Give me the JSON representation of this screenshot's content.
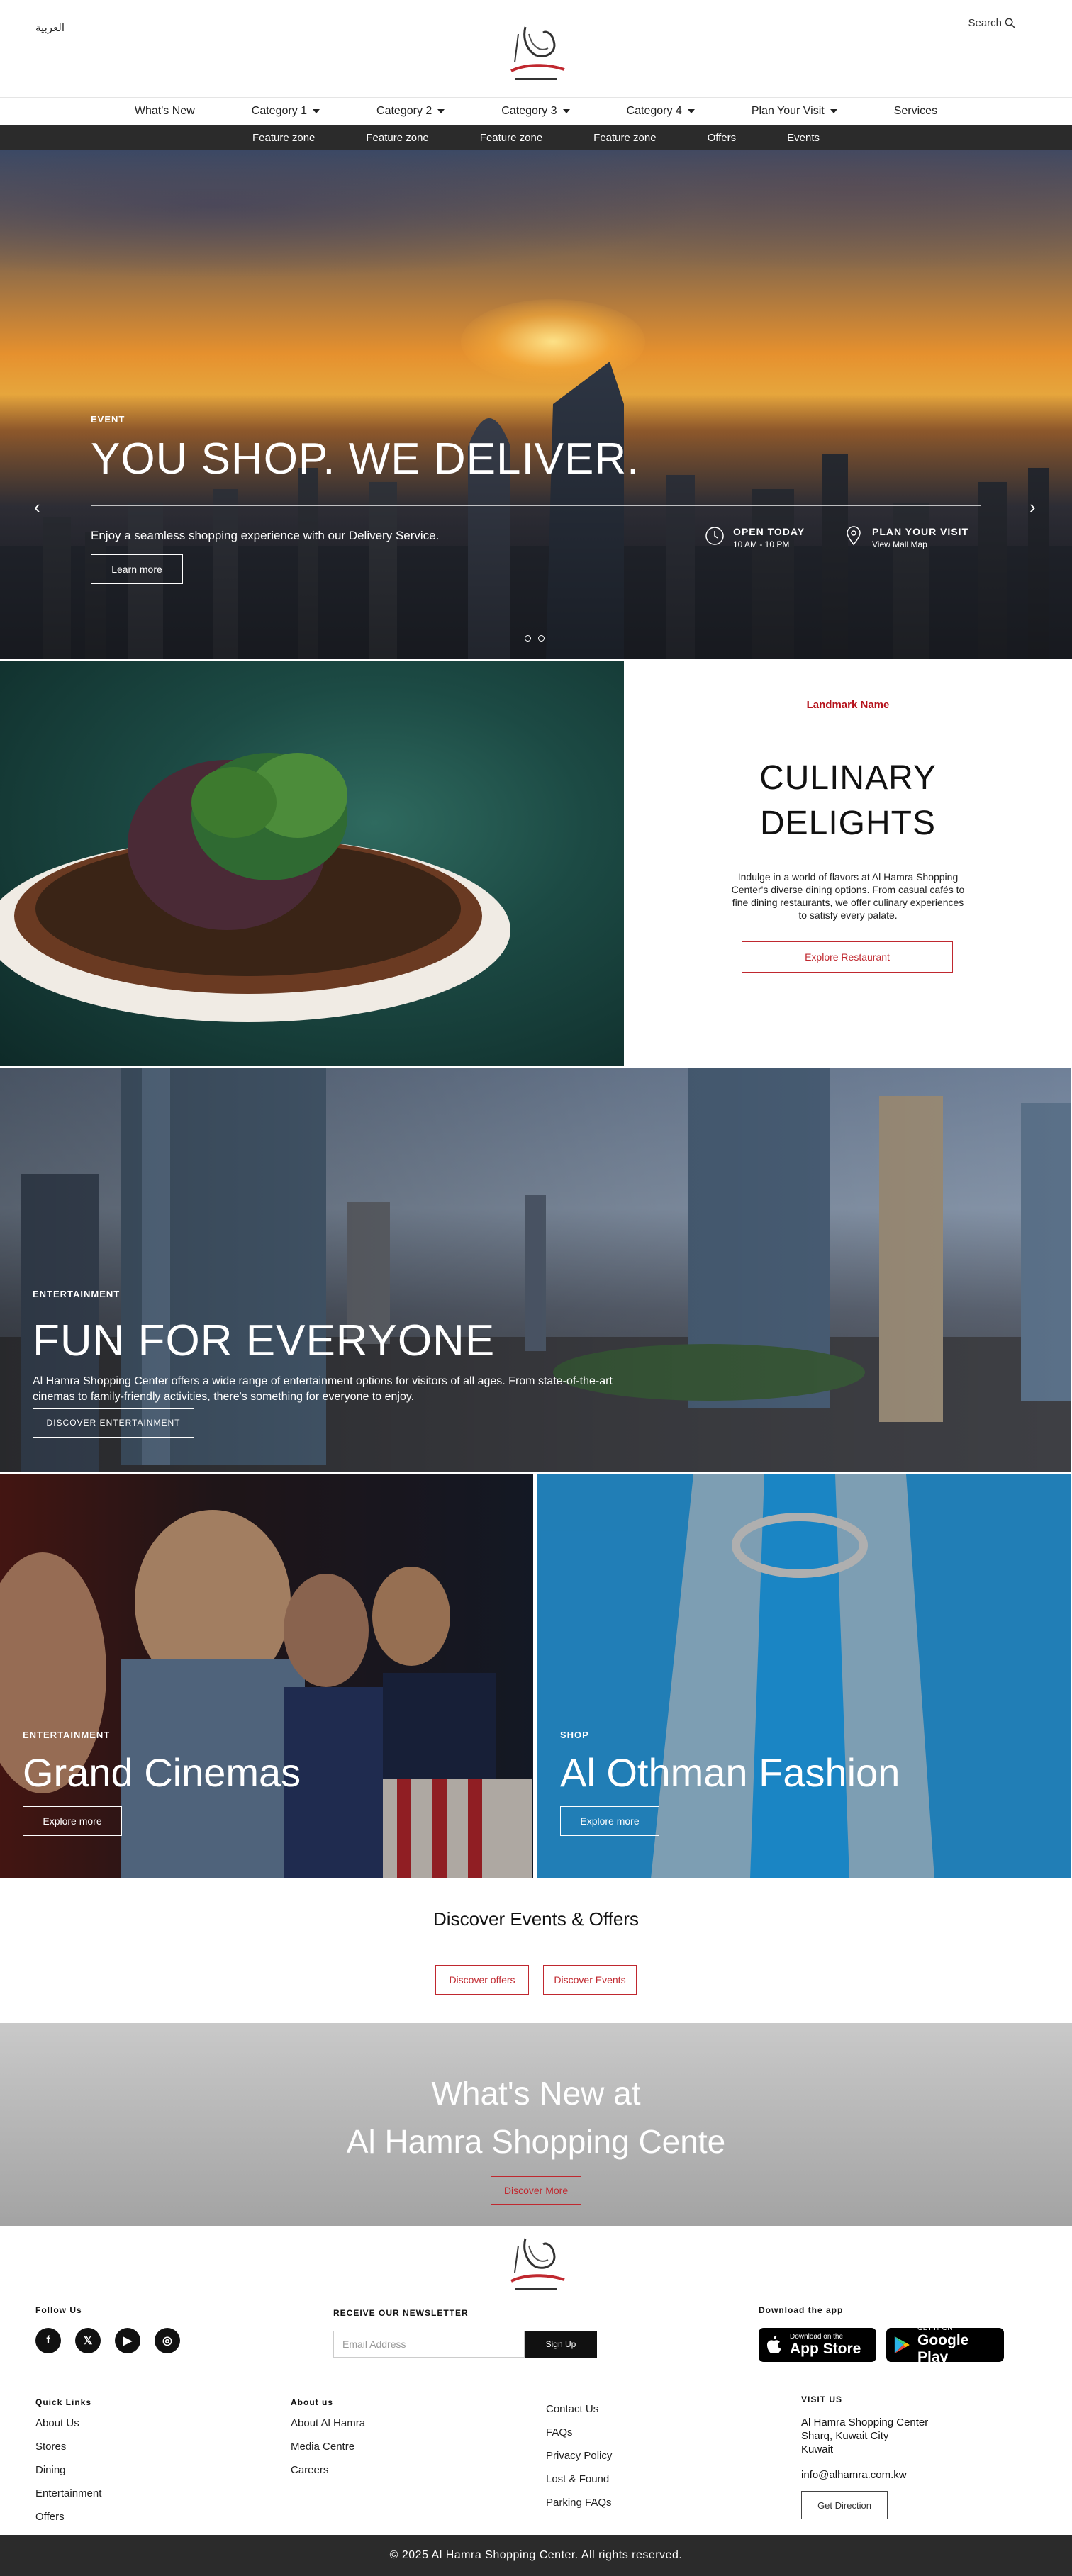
{
  "header": {
    "language": "العربية",
    "search": "Search",
    "logo_text": "AL HAMRA"
  },
  "nav_primary": [
    {
      "label": "What's New",
      "caret": false
    },
    {
      "label": "Category 1",
      "caret": true
    },
    {
      "label": "Category 2",
      "caret": true
    },
    {
      "label": "Category 3",
      "caret": true
    },
    {
      "label": "Category 4",
      "caret": true
    },
    {
      "label": "Plan Your Visit",
      "caret": true
    },
    {
      "label": "Services",
      "caret": false
    }
  ],
  "nav_secondary": [
    "Feature zone",
    "Feature zone",
    "Feature zone",
    "Feature zone",
    "Offers",
    "Events"
  ],
  "hero": {
    "tag": "EVENT",
    "title": "YOU SHOP. WE DELIVER.",
    "subtitle": "Enjoy a seamless shopping experience with our Delivery Service.",
    "button": "Learn more",
    "open_title": "OPEN TODAY",
    "open_hours": "10 AM - 10 PM",
    "plan_title": "PLAN YOUR VISIT",
    "plan_sub": "View Mall Map"
  },
  "culinary": {
    "landmark": "Landmark Name",
    "title_line1": "CULINARY",
    "title_line2": "DELIGHTS",
    "description": "Indulge in a world of flavors at Al Hamra Shopping Center's diverse dining options. From casual cafés to fine dining restaurants, we offer culinary experiences to satisfy every palate.",
    "button": "Explore Restaurant"
  },
  "fun": {
    "tag": "ENTERTAINMENT",
    "title": "FUN FOR EVERYONE",
    "description": "Al Hamra Shopping Center offers a wide range of entertainment options for visitors of all ages. From state-of-the-art cinemas to family-friendly activities, there's something for everyone to enjoy.",
    "button": "DISCOVER ENTERTAINMENT"
  },
  "cards": [
    {
      "tag": "ENTERTAINMENT",
      "title": "Grand Cinemas",
      "button": "Explore more"
    },
    {
      "tag": "SHOP",
      "title": "Al Othman Fashion",
      "button": "Explore more"
    }
  ],
  "discover": {
    "title": "Discover Events & Offers",
    "btn_offers": "Discover offers",
    "btn_events": "Discover Events"
  },
  "whats_new": {
    "line1": "What's New at",
    "line2": "Al Hamra Shopping Cente",
    "button": "Discover More"
  },
  "footer": {
    "follow_label": "Follow Us",
    "socials": [
      "f",
      "𝕏",
      "▶",
      "◎"
    ],
    "newsletter_label": "RECEIVE OUR NEWSLETTER",
    "newsletter_placeholder": "Email Address",
    "newsletter_button": "Sign Up",
    "download_label": "Download the app",
    "appstore_small": "Download on the",
    "appstore_big": "App Store",
    "googleplay_small": "GET IT ON",
    "googleplay_big": "Google Play",
    "quick_links_label": "Quick Links",
    "quick_links": [
      "About Us",
      "Stores",
      "Dining",
      "Entertainment",
      "Offers"
    ],
    "about_label": "About us",
    "about_links": [
      "About Al Hamra",
      "Media Centre",
      "Careers"
    ],
    "misc_links": [
      "Contact Us",
      "FAQs",
      "Privacy Policy",
      "Lost & Found",
      "Parking FAQs"
    ],
    "visit_label": "VISIT US",
    "visit_line1": "Al Hamra Shopping Center",
    "visit_line2": "Sharq, Kuwait City",
    "visit_line3": "Kuwait",
    "visit_email": "info@alhamra.com.kw",
    "direction_button": "Get Direction",
    "copyright": "© 2025 Al Hamra Shopping Center. All rights reserved."
  }
}
